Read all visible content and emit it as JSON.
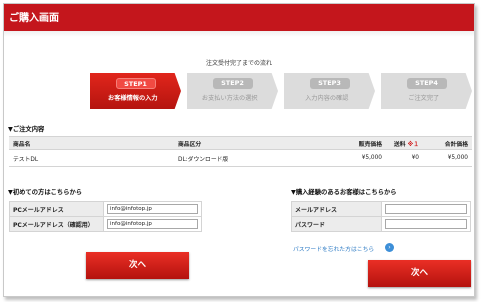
{
  "header": {
    "title": "ご購入画面"
  },
  "flow": {
    "title": "注文受付完了までの流れ",
    "steps": [
      {
        "badge": "STEP1",
        "label": "お客様情報の入力"
      },
      {
        "badge": "STEP2",
        "label": "お支払い方法の選択"
      },
      {
        "badge": "STEP3",
        "label": "入力内容の確認"
      },
      {
        "badge": "STEP4",
        "label": "ご注文完了"
      }
    ]
  },
  "order": {
    "heading": "▼ご注文内容",
    "columns": {
      "name": "商品名",
      "category": "商品区分",
      "price": "販売価格",
      "shipping": "送料",
      "shipping_mark": "※１",
      "total": "合計価格"
    },
    "rows": [
      {
        "name": "テストDL",
        "category": "DL:ダウンロード版",
        "price": "¥5,000",
        "shipping": "¥0",
        "total": "¥5,000"
      }
    ]
  },
  "new_customer": {
    "heading": "▼初めての方はこちらから",
    "email_label": "PCメールアドレス",
    "email_value": "info@infotop.jp",
    "email_confirm_label": "PCメールアドレス（確認用）",
    "email_confirm_value": "info@infotop.jp",
    "next_label": "次へ"
  },
  "returning_customer": {
    "heading": "▼購入経験のあるお客様はこちらから",
    "email_label": "メールアドレス",
    "email_value": "",
    "password_label": "パスワード",
    "password_value": "",
    "forgot_link": "パスワードを忘れた方はこちら",
    "forgot_icon": "arrow-circle-icon",
    "next_label": "次へ"
  },
  "colors": {
    "accent": "#c4161c",
    "button": "#d61f19",
    "link": "#2c7ac4"
  }
}
